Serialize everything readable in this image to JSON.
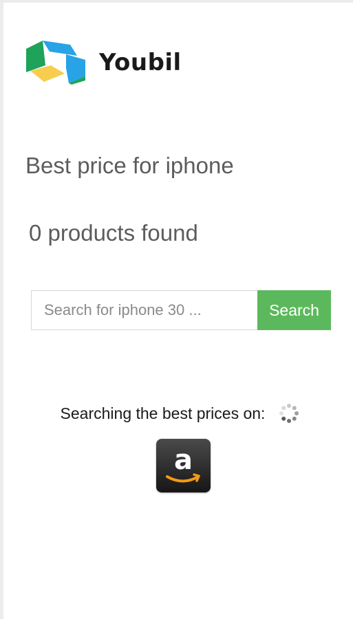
{
  "brand": {
    "name": "Youbil",
    "logo_icon": "youbil-logo-icon"
  },
  "main": {
    "title": "Best price for iphone",
    "result_count": "0 products found"
  },
  "search": {
    "placeholder": "Search for iphone 30 ...",
    "value": "",
    "button_label": "Search"
  },
  "status": {
    "text": "Searching the best prices on:",
    "spinner_icon": "loading-spinner-icon",
    "stores": [
      {
        "name": "Amazon",
        "icon": "amazon-logo-icon",
        "logo_letter": "a"
      }
    ]
  },
  "colors": {
    "accent_green": "#5cb85c",
    "logo_green": "#1fa25a",
    "logo_blue": "#27a3e6",
    "logo_yellow": "#f7cd4f",
    "text_gray": "#5c5c5c",
    "amazon_orange": "#f49a15",
    "amazon_dark": "#262626"
  }
}
